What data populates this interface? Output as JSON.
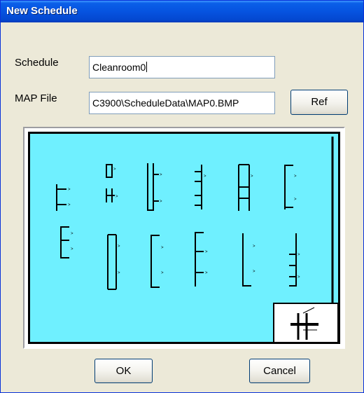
{
  "window": {
    "title": "New Schedule"
  },
  "form": {
    "schedule_label": "Schedule",
    "schedule_value": "Cleanroom0",
    "map_label": "MAP File",
    "map_value": "C3900\\ScheduleData\\MAP0.BMP",
    "ref_label": "Ref"
  },
  "map": {
    "background_color": "#6ff0ff"
  },
  "buttons": {
    "ok_label": "OK",
    "cancel_label": "Cancel"
  }
}
